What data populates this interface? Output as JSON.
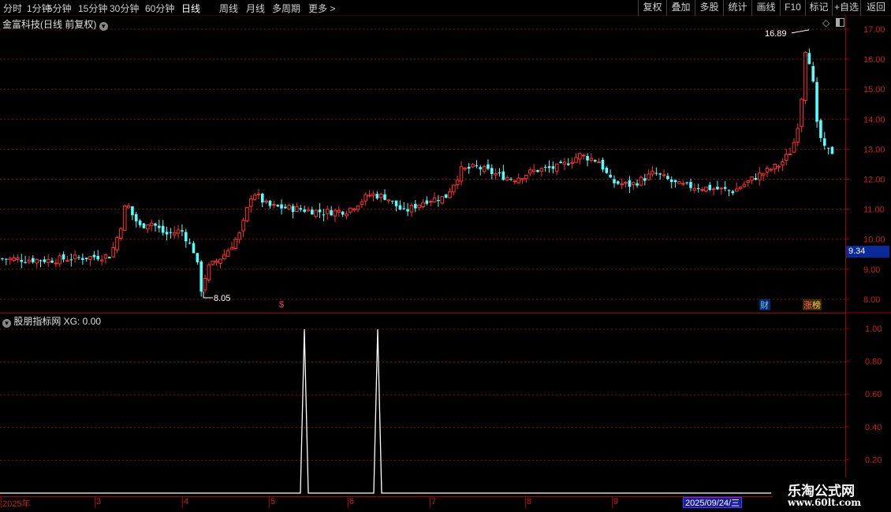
{
  "toolbar": {
    "periods": [
      "分时",
      "1分钟",
      "5分钟",
      "15分钟",
      "30分钟",
      "60分钟",
      "日线",
      "周线",
      "月线",
      "多周期",
      "更多 >"
    ],
    "active_period": "日线",
    "right_buttons": [
      "复权",
      "叠加",
      "多股",
      "统计",
      "画线",
      "F10",
      "标记",
      "+自选",
      "返回"
    ]
  },
  "main_chart": {
    "title": "金富科技(日线 前复权)",
    "high_label": "16.89",
    "low_label": "8.05",
    "current_price": "9.34",
    "markers": [
      "$",
      "财",
      "涨",
      "榜"
    ]
  },
  "indicator": {
    "title": "股朋指标网 XG: 0.00"
  },
  "axis": {
    "price_ticks": [
      "17.00",
      "16.00",
      "15.00",
      "14.00",
      "13.00",
      "12.00",
      "11.00",
      "10.00",
      "9.00",
      "8.00"
    ],
    "indicator_ticks": [
      "1.00",
      "0.80",
      "0.60",
      "0.40",
      "0.20"
    ],
    "dates": [
      "2025年",
      "3",
      "4",
      "5",
      "6",
      "7",
      "8",
      "9"
    ],
    "current_date": "2025/09/24/三"
  },
  "watermark": {
    "title": "乐淘公式网",
    "url": "www.60lt.com"
  },
  "colors": {
    "up": "#ff3030",
    "down": "#54ffff",
    "grid": "#8a1010",
    "axis_text": "#c82020",
    "signal": "#ffffff"
  },
  "chart_data": {
    "type": "candlestick",
    "price_ylim": [
      8.0,
      17.0
    ],
    "indicator_ylim": [
      0.0,
      1.0
    ],
    "months": [
      "2025年",
      "3",
      "4",
      "5",
      "6",
      "7",
      "8",
      "9"
    ],
    "price_path_approx": [
      {
        "month": "2025年",
        "close": 9.4
      },
      {
        "month": "3",
        "close": 11.0
      },
      {
        "month": "4",
        "close": 8.05
      },
      {
        "month": "4",
        "close": 11.8
      },
      {
        "month": "5",
        "close": 11.0
      },
      {
        "month": "6",
        "close": 11.5
      },
      {
        "month": "7",
        "close": 12.6
      },
      {
        "month": "8",
        "close": 12.8
      },
      {
        "month": "9",
        "close": 11.7
      },
      {
        "month": "9",
        "close": 16.89
      },
      {
        "month": "9",
        "close": 12.9
      }
    ],
    "series": [
      {
        "name": "XG",
        "spikes": [
          {
            "month": "5",
            "value": 1.0
          },
          {
            "month": "6",
            "value": 1.0
          }
        ],
        "last_value": 0.0
      }
    ]
  }
}
